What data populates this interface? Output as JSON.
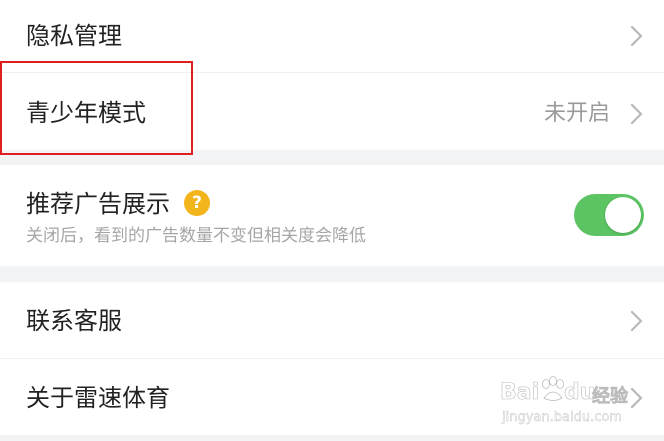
{
  "settings": {
    "items": [
      {
        "label": "隐私管理"
      },
      {
        "label": "青少年模式",
        "status": "未开启"
      },
      {
        "label": "推荐广告展示",
        "help_icon_text": "?",
        "description": "关闭后，看到的广告数量不变但相关度会降低",
        "toggle_on": true
      },
      {
        "label": "联系客服"
      },
      {
        "label": "关于雷速体育"
      }
    ]
  },
  "watermark": {
    "logo_text": "Bai",
    "logo_text2": "du",
    "logo_cn": "经验",
    "url": "jingyan.baidu.com"
  },
  "colors": {
    "toggle_on": "#5cc463",
    "help_icon": "#f2b51c",
    "highlight_border": "#e02020",
    "section_gap": "#f3f4f6"
  },
  "icons": {
    "chevron": "chevron-right-icon",
    "help": "question-circle-icon"
  }
}
